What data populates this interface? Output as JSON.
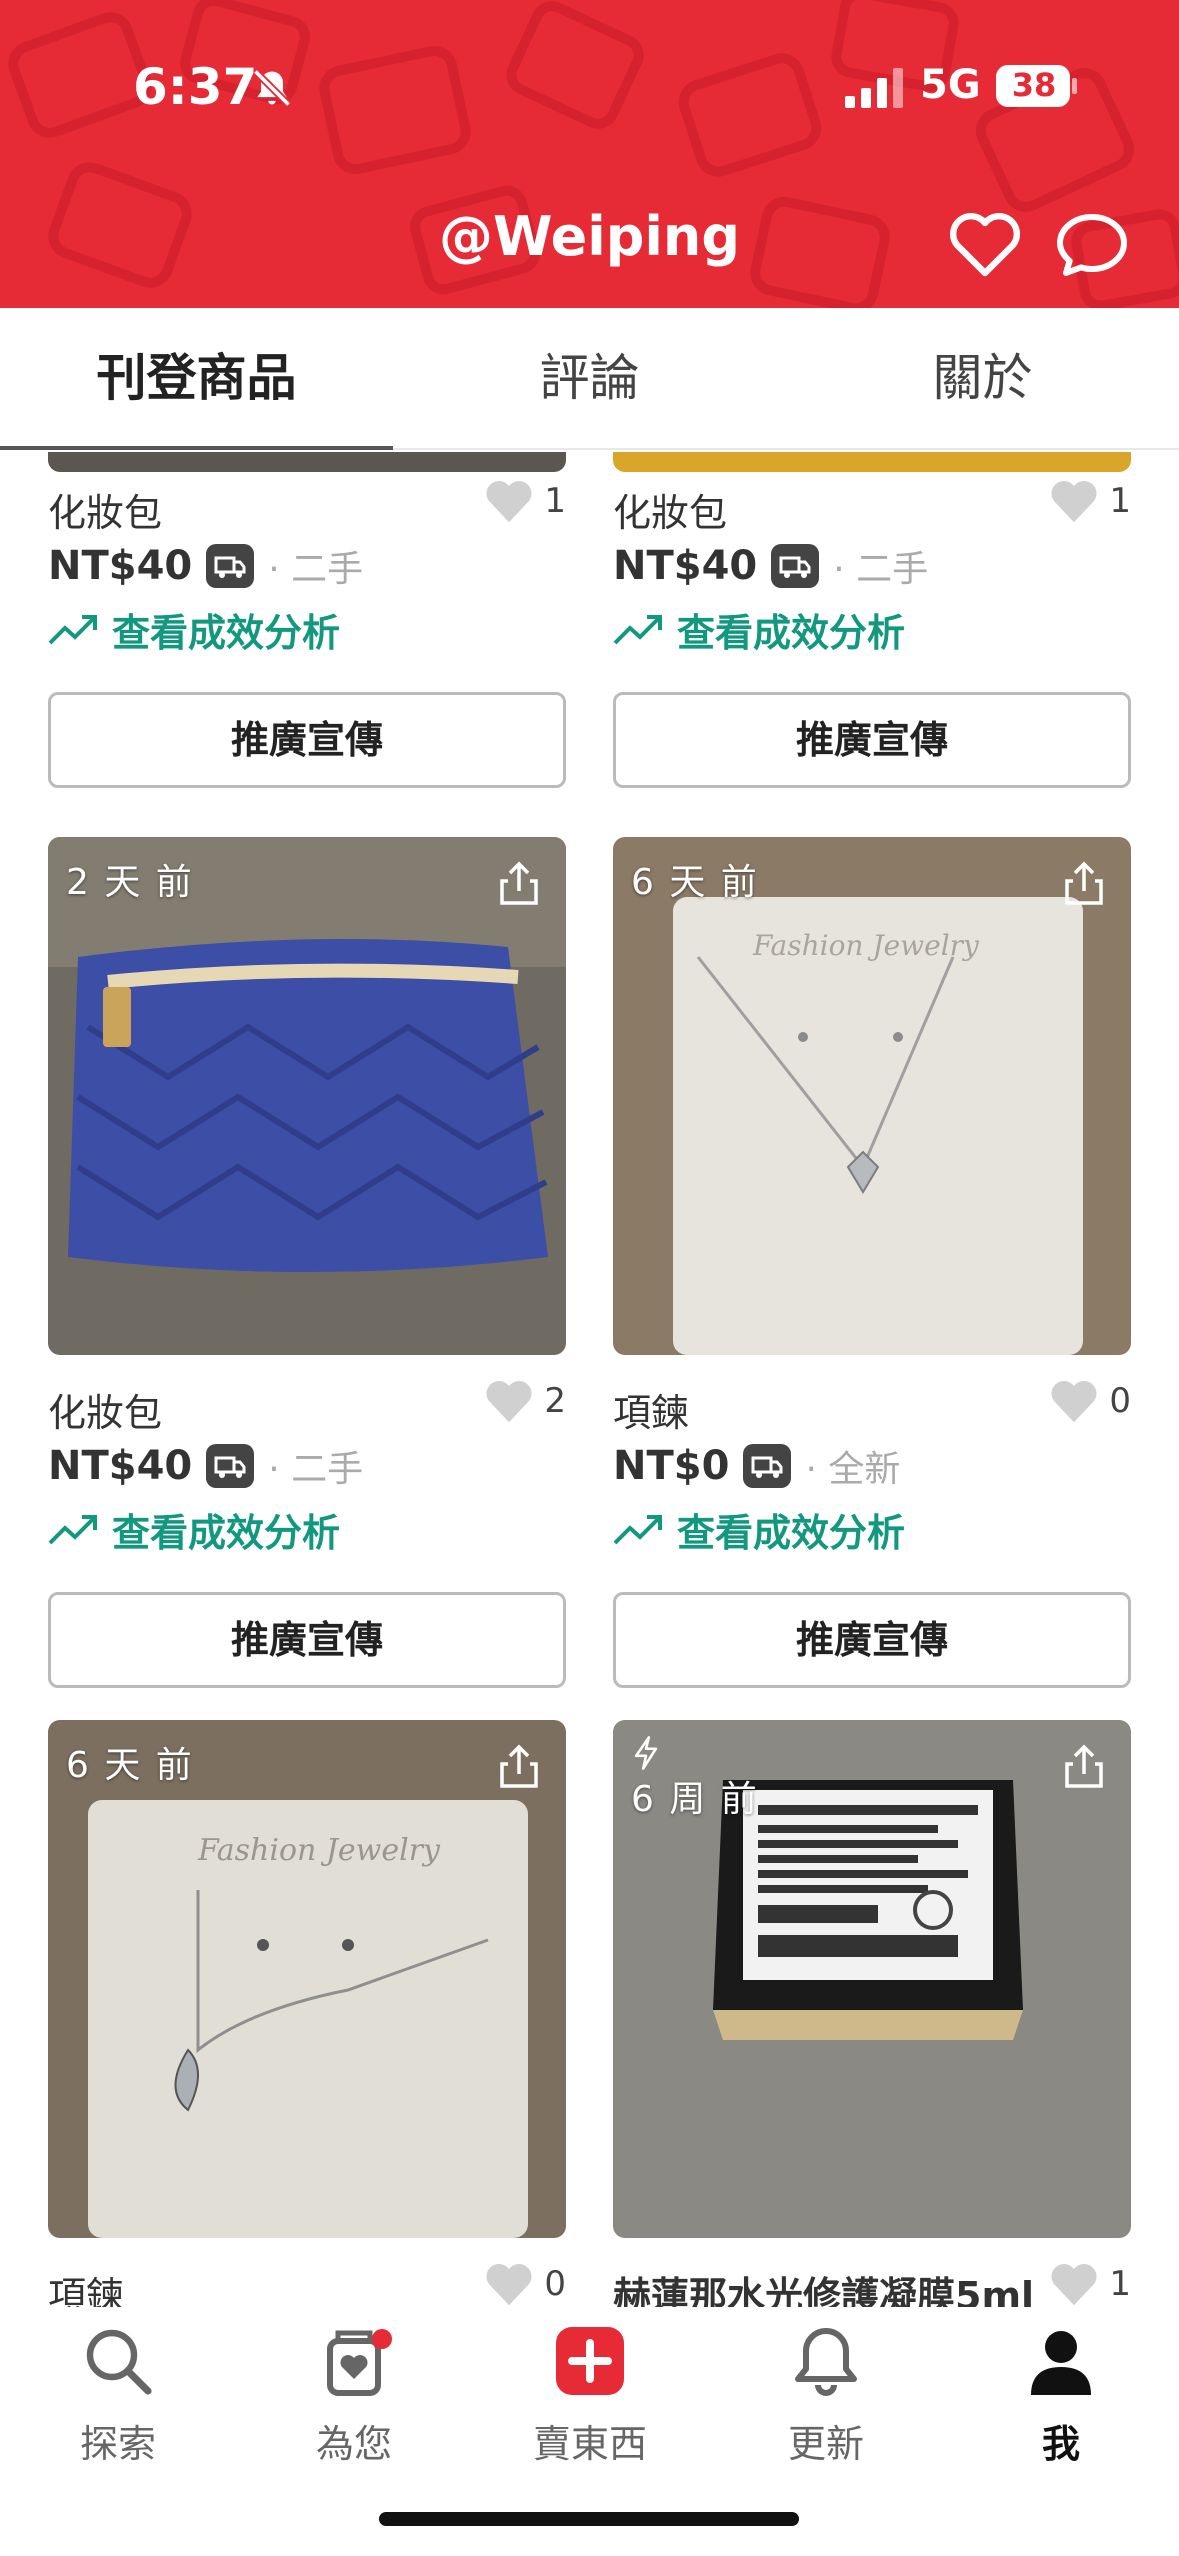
{
  "status_bar": {
    "time": "6:37",
    "network": "5G",
    "battery": "38"
  },
  "header": {
    "username": "@Weiping",
    "accent_color": "#e72b36"
  },
  "tabs": [
    {
      "label": "刊登商品",
      "active": true
    },
    {
      "label": "評論",
      "active": false
    },
    {
      "label": "關於",
      "active": false
    }
  ],
  "listings": [
    {
      "title": "化妝包",
      "likes": "1",
      "price": "NT$40",
      "condition": "· 二手",
      "analysis": "查看成效分析",
      "promote": "推廣宣傳"
    },
    {
      "title": "化妝包",
      "likes": "1",
      "price": "NT$40",
      "condition": "· 二手",
      "analysis": "查看成效分析",
      "promote": "推廣宣傳"
    },
    {
      "time": "2 天 前",
      "title": "化妝包",
      "likes": "2",
      "price": "NT$40",
      "condition": "· 二手",
      "analysis": "查看成效分析",
      "promote": "推廣宣傳",
      "image": "blue-quilted-pouch"
    },
    {
      "time": "6 天 前",
      "title": "項鍊",
      "likes": "0",
      "price": "NT$0",
      "condition": "· 全新",
      "analysis": "查看成效分析",
      "promote": "推廣宣傳",
      "image": "necklace-on-card"
    },
    {
      "time": "6 天 前",
      "title": "項鍊",
      "likes": "0",
      "image": "necklace-on-card"
    },
    {
      "time": "6 周 前",
      "title": "赫蓮那水光修護凝膜5ml",
      "likes": "1",
      "image": "cosmetic-box"
    }
  ],
  "bottom_nav": [
    {
      "label": "探索",
      "icon": "search-icon"
    },
    {
      "label": "為您",
      "icon": "heart-bag-icon",
      "badge": true
    },
    {
      "label": "賣東西",
      "icon": "plus-icon"
    },
    {
      "label": "更新",
      "icon": "bell-icon"
    },
    {
      "label": "我",
      "icon": "person-icon",
      "active": true
    }
  ]
}
